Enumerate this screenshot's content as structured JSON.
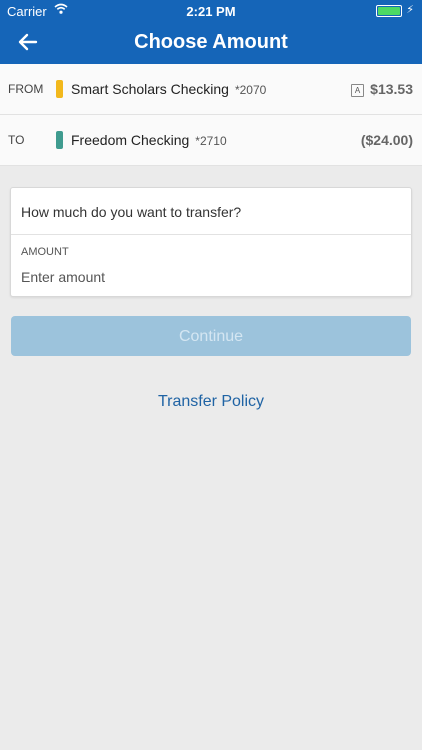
{
  "status_bar": {
    "carrier": "Carrier",
    "time": "2:21 PM"
  },
  "nav": {
    "title": "Choose Amount"
  },
  "from_account": {
    "direction": "FROM",
    "name": "Smart Scholars Checking",
    "number": "*2070",
    "badge": "A",
    "amount": "$13.53",
    "color": "#f2b81c"
  },
  "to_account": {
    "direction": "TO",
    "name": "Freedom Checking",
    "number": "*2710",
    "amount": "($24.00)",
    "color": "#3f9b8f"
  },
  "form": {
    "question": "How much do you want to transfer?",
    "amount_label": "AMOUNT",
    "amount_placeholder": "Enter amount",
    "amount_value": ""
  },
  "actions": {
    "continue_label": "Continue",
    "policy_link": "Transfer Policy"
  }
}
